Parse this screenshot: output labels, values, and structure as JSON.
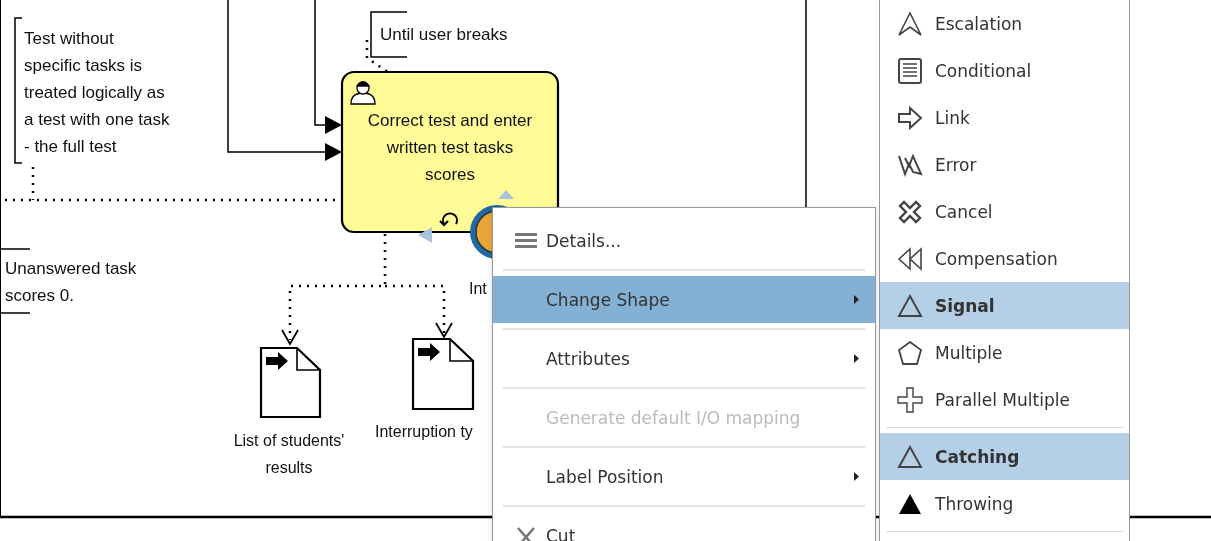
{
  "diagram": {
    "annotations": [
      {
        "text": "Test without\nspecific tasks is\ntreated logically as\na test with one task\n- the full test"
      },
      {
        "text": "Until user breaks"
      },
      {
        "text": "Unanswered task\nscores 0."
      }
    ],
    "task": {
      "label": "Correct test and enter\nwritten test tasks\nscores"
    },
    "event_label": "Int",
    "data_objects": [
      {
        "label": "List of students'\nresults"
      },
      {
        "label": "Interruption ty"
      }
    ]
  },
  "context_menu": {
    "items": [
      {
        "label": "Details...",
        "kind": "details",
        "selected": false,
        "disabled": false,
        "has_submenu": false
      },
      {
        "label": "Change Shape",
        "kind": "plain",
        "selected": true,
        "disabled": false,
        "has_submenu": true
      },
      {
        "label": "Attributes",
        "kind": "plain",
        "selected": false,
        "disabled": false,
        "has_submenu": true
      },
      {
        "label": "Generate default I/O mapping",
        "kind": "plain",
        "selected": false,
        "disabled": true,
        "has_submenu": false
      },
      {
        "label": "Label Position",
        "kind": "plain",
        "selected": false,
        "disabled": false,
        "has_submenu": true
      },
      {
        "label": "Cut",
        "kind": "cut",
        "selected": false,
        "disabled": false,
        "has_submenu": false
      }
    ]
  },
  "submenu": {
    "event_types": [
      {
        "label": "Escalation",
        "kind": "escalation",
        "selected": false
      },
      {
        "label": "Conditional",
        "kind": "conditional",
        "selected": false
      },
      {
        "label": "Link",
        "kind": "link",
        "selected": false
      },
      {
        "label": "Error",
        "kind": "error",
        "selected": false
      },
      {
        "label": "Cancel",
        "kind": "cancel",
        "selected": false
      },
      {
        "label": "Compensation",
        "kind": "compensation",
        "selected": false
      },
      {
        "label": "Signal",
        "kind": "signal",
        "selected": true
      },
      {
        "label": "Multiple",
        "kind": "multiple",
        "selected": false
      },
      {
        "label": "Parallel Multiple",
        "kind": "parallel",
        "selected": false
      }
    ],
    "directions": [
      {
        "label": "Catching",
        "kind": "catching",
        "selected": true
      },
      {
        "label": "Throwing",
        "kind": "throwing",
        "selected": false
      }
    ]
  }
}
